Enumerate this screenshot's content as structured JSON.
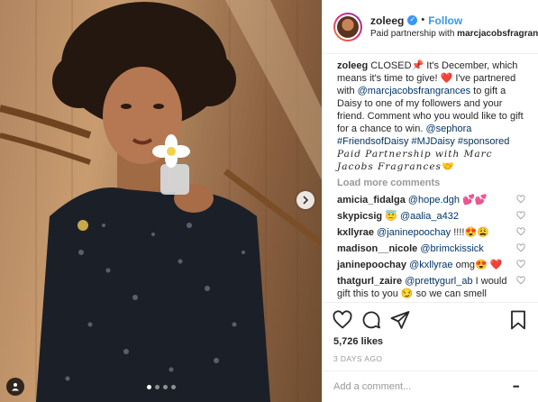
{
  "post": {
    "username": "zoleeg",
    "verified_glyph": "✓",
    "bullet": "•",
    "follow_label": "Follow",
    "partnership_prefix": "Paid partnership with ",
    "partnership_brand": "marcjacobsfragrances",
    "caption": {
      "username": "zoleeg",
      "text_1": " CLOSED📌 It's December, which means it's time to give! ❤️ I've partnered with ",
      "mention": "@marcjacobsfrangrances",
      "text_2": " to gift a Daisy to one of my followers and your friend. Comment who you would like to gift for a chance to win. ",
      "tags": "@sephora #FriendsofDaisy #MJDaisy #sponsored",
      "script_text": "Paid Partnership with Marc Jacobs Fragrances",
      "script_emoji": "🤝"
    },
    "load_more_label": "Load more comments",
    "comments": [
      {
        "user": "amicia_fidalga",
        "mention": "@hope.dgh",
        "text": " 💕💕"
      },
      {
        "user": "skypicsig",
        "mention": "",
        "text": " 😇 ",
        "mention2": "@aalia_a432"
      },
      {
        "user": "kxllyrae",
        "mention": "@janinepoochay",
        "text": " !!!!😍😩"
      },
      {
        "user": "madison__nicole",
        "mention": "@brimckissick",
        "text": ""
      },
      {
        "user": "janinepoochay",
        "mention": "@kxllyrae",
        "text": " omg😍 ❤️"
      },
      {
        "user": "thatgurl_zaire",
        "mention": "@prettygurl_ab",
        "text": " I would gift this to you 😏 so we can smell good and get all the boyeees"
      }
    ],
    "likes": "5,726 likes",
    "date": "3 DAYS AGO",
    "add_comment_placeholder": "Add a comment...",
    "more_glyph": "•••",
    "icons": {
      "like": "heart-outline-icon",
      "comment": "speech-bubble-icon",
      "share": "paper-plane-icon",
      "save": "bookmark-icon",
      "next": "chevron-right-icon",
      "tag": "person-tag-icon"
    },
    "carousel": {
      "count": 4,
      "active": 0
    },
    "colors": {
      "link": "#003569",
      "follow": "#3897f0",
      "muted": "#999999"
    }
  }
}
